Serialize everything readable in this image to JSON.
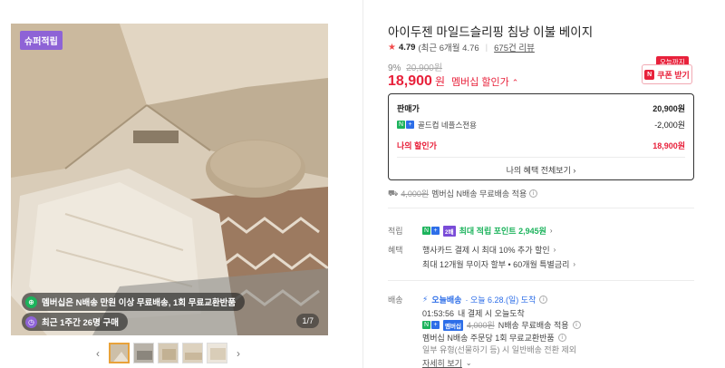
{
  "gallery": {
    "super_badge": "슈퍼적립",
    "pill_membership": "멤버십은 N배송 만원 이상 무료배송, 1회 무료교환반품",
    "pill_recent": "최근 1주간 26명 구매",
    "counter": "1/7",
    "prev_arrow": "‹",
    "next_arrow": "›"
  },
  "product": {
    "title": "아이두젠 마일드슬리핑 침낭 이불 베이지",
    "rating": {
      "score": "4.79",
      "recent": "(최근 6개월 4.76",
      "reviews": "675건 리뷰"
    },
    "discount_pct": "9%",
    "original_price": "20,900원",
    "price": "18,900",
    "price_unit": "원",
    "member_discount": "멤버십 할인가",
    "coupon": {
      "tag": "오늘까지",
      "label": "쿠폰 받기",
      "n_mark": "N"
    },
    "benefits": {
      "sale_price_label": "판매가",
      "sale_price_value": "20,900원",
      "nplus_label": "골드컵 네플스전용",
      "nplus_value": "-2,000원",
      "my_price_label": "나의 할인가",
      "my_price_value": "18,900원",
      "view_all": "나의 혜택 전체보기 ›"
    },
    "membership_shipping": {
      "old": "4,000원",
      "text": "멤버십 N배송 무료배송 적용"
    },
    "points": {
      "label": "적립",
      "badge": "2배",
      "text": "최대 적립 포인트 2,945원",
      "chev": "›"
    },
    "benefit": {
      "label": "혜택",
      "line1": "행사카드 결제 시 최대 10% 추가 할인",
      "line1_chev": "›",
      "line2": "최대 12개월 무이자 할부 • 60개월 특별금리",
      "line2_chev": "›"
    },
    "shipping": {
      "label": "배송",
      "today": "오늘배송",
      "today_detail": "· 오늘 6.28.(일) 도착",
      "time": "01:53:56",
      "time_text": "내 결제 시 오늘도착",
      "fee_badge": "멤버십",
      "fee_old": "4,000원",
      "fee_text": "N배송 무료배송 적용",
      "member_line": "멤버십 N배송 주문당 1회 무료교환반품",
      "exclude_line": "일부 유형(선물하기 등) 시 일반배송 전환 제외",
      "detail_link": "자세히 보기"
    }
  },
  "colors": {
    "accent_red": "#e8213b",
    "npay_green": "#1cb35c",
    "npay_blue": "#2d6ee8",
    "super_purple": "#8e63d6"
  }
}
